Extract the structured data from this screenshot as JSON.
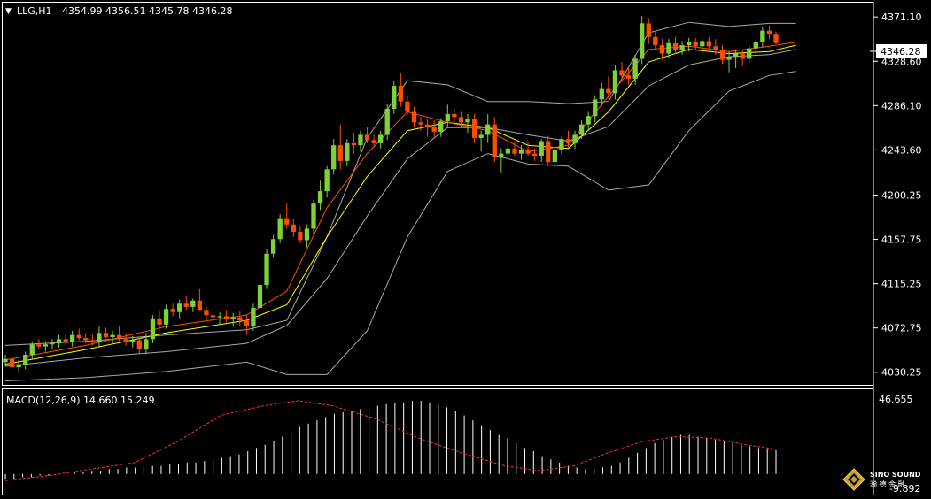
{
  "header": {
    "symbol": "LLG,H1",
    "ohlc": "4354.99 4356.51 4345.78 4346.28"
  },
  "price_axis": {
    "ticks": [
      "4371.10",
      "4328.60",
      "4286.10",
      "4243.60",
      "4200.25",
      "4157.75",
      "4115.25",
      "4072.75",
      "4030.25"
    ],
    "current_price": "4346.28"
  },
  "macd": {
    "label": "MACD(12,26,9) 14.660 15.249",
    "axis_top": "46.655",
    "axis_bottom": "-9.892"
  },
  "logo": {
    "line1": "SINO SOUND",
    "line2": "瀚 德 金 融"
  },
  "colors": {
    "background": "#000000",
    "bull": "#7fd13b",
    "bear": "#ff4d00",
    "bollinger": "#a8a8a8",
    "ma_fast": "#ff4d00",
    "ma_slow": "#ffff00",
    "macd_hist": "#ffffff",
    "macd_signal": "#ff3030",
    "axis_text": "#ffffff"
  },
  "chart_data": [
    {
      "type": "candlestick",
      "symbol": "LLG",
      "timeframe": "H1",
      "ylim": [
        4019,
        4384
      ],
      "yticks": [
        4371.1,
        4328.6,
        4286.1,
        4243.6,
        4200.25,
        4157.75,
        4115.25,
        4072.75,
        4030.25
      ],
      "last_price": 4346.28,
      "candles": [
        [
          4040,
          4047,
          4036,
          4043
        ],
        [
          4043,
          4045,
          4032,
          4035
        ],
        [
          4035,
          4042,
          4030,
          4038
        ],
        [
          4038,
          4050,
          4033,
          4047
        ],
        [
          4047,
          4060,
          4043,
          4057
        ],
        [
          4057,
          4062,
          4052,
          4055
        ],
        [
          4055,
          4060,
          4050,
          4057
        ],
        [
          4057,
          4062,
          4052,
          4058
        ],
        [
          4058,
          4066,
          4054,
          4062
        ],
        [
          4062,
          4066,
          4056,
          4059
        ],
        [
          4059,
          4070,
          4055,
          4066
        ],
        [
          4066,
          4072,
          4061,
          4063
        ],
        [
          4063,
          4068,
          4058,
          4061
        ],
        [
          4061,
          4066,
          4056,
          4059
        ],
        [
          4059,
          4074,
          4055,
          4068
        ],
        [
          4068,
          4073,
          4063,
          4064
        ],
        [
          4064,
          4070,
          4058,
          4066
        ],
        [
          4066,
          4074,
          4060,
          4062
        ],
        [
          4062,
          4068,
          4056,
          4059
        ],
        [
          4059,
          4065,
          4054,
          4061
        ],
        [
          4061,
          4064,
          4048,
          4052
        ],
        [
          4052,
          4068,
          4048,
          4062
        ],
        [
          4062,
          4085,
          4058,
          4082
        ],
        [
          4082,
          4090,
          4073,
          4076
        ],
        [
          4076,
          4095,
          4072,
          4091
        ],
        [
          4091,
          4096,
          4084,
          4088
        ],
        [
          4088,
          4100,
          4082,
          4096
        ],
        [
          4096,
          4103,
          4090,
          4093
        ],
        [
          4093,
          4101,
          4088,
          4099
        ],
        [
          4099,
          4110,
          4094,
          4090
        ],
        [
          4090,
          4093,
          4080,
          4085
        ],
        [
          4085,
          4090,
          4077,
          4083
        ],
        [
          4083,
          4088,
          4076,
          4084
        ],
        [
          4084,
          4090,
          4078,
          4081
        ],
        [
          4081,
          4087,
          4075,
          4083
        ],
        [
          4083,
          4089,
          4075,
          4080
        ],
        [
          4080,
          4085,
          4066,
          4075
        ],
        [
          4075,
          4096,
          4070,
          4092
        ],
        [
          4092,
          4118,
          4088,
          4114
        ],
        [
          4114,
          4148,
          4110,
          4144
        ],
        [
          4144,
          4162,
          4140,
          4158
        ],
        [
          4158,
          4182,
          4154,
          4178
        ],
        [
          4178,
          4192,
          4168,
          4172
        ],
        [
          4172,
          4177,
          4160,
          4165
        ],
        [
          4165,
          4170,
          4154,
          4157
        ],
        [
          4157,
          4172,
          4150,
          4168
        ],
        [
          4168,
          4196,
          4163,
          4192
        ],
        [
          4192,
          4214,
          4186,
          4204
        ],
        [
          4204,
          4228,
          4198,
          4225
        ],
        [
          4225,
          4254,
          4220,
          4248
        ],
        [
          4248,
          4268,
          4225,
          4233
        ],
        [
          4233,
          4254,
          4228,
          4250
        ],
        [
          4250,
          4260,
          4240,
          4248
        ],
        [
          4248,
          4262,
          4242,
          4258
        ],
        [
          4258,
          4266,
          4250,
          4253
        ],
        [
          4253,
          4258,
          4246,
          4250
        ],
        [
          4250,
          4262,
          4245,
          4258
        ],
        [
          4258,
          4288,
          4253,
          4283
        ],
        [
          4283,
          4310,
          4278,
          4305
        ],
        [
          4305,
          4317,
          4285,
          4290
        ],
        [
          4290,
          4295,
          4277,
          4280
        ],
        [
          4280,
          4285,
          4266,
          4270
        ],
        [
          4270,
          4275,
          4262,
          4268
        ],
        [
          4268,
          4273,
          4256,
          4266
        ],
        [
          4266,
          4272,
          4255,
          4261
        ],
        [
          4261,
          4274,
          4256,
          4271
        ],
        [
          4271,
          4287,
          4266,
          4278
        ],
        [
          4278,
          4283,
          4270,
          4275
        ],
        [
          4275,
          4280,
          4266,
          4270
        ],
        [
          4270,
          4278,
          4260,
          4273
        ],
        [
          4273,
          4278,
          4250,
          4255
        ],
        [
          4255,
          4262,
          4242,
          4258
        ],
        [
          4258,
          4278,
          4250,
          4268
        ],
        [
          4268,
          4275,
          4232,
          4236
        ],
        [
          4236,
          4245,
          4222,
          4240
        ],
        [
          4240,
          4250,
          4235,
          4245
        ],
        [
          4245,
          4251,
          4238,
          4240
        ],
        [
          4240,
          4248,
          4234,
          4244
        ],
        [
          4244,
          4251,
          4238,
          4240
        ],
        [
          4240,
          4245,
          4233,
          4238
        ],
        [
          4238,
          4254,
          4232,
          4252
        ],
        [
          4252,
          4257,
          4228,
          4232
        ],
        [
          4232,
          4246,
          4226,
          4244
        ],
        [
          4244,
          4256,
          4240,
          4254
        ],
        [
          4254,
          4262,
          4246,
          4250
        ],
        [
          4250,
          4262,
          4245,
          4258
        ],
        [
          4258,
          4272,
          4254,
          4268
        ],
        [
          4268,
          4280,
          4262,
          4276
        ],
        [
          4276,
          4296,
          4270,
          4292
        ],
        [
          4292,
          4308,
          4286,
          4302
        ],
        [
          4302,
          4314,
          4293,
          4298
        ],
        [
          4298,
          4325,
          4292,
          4320
        ],
        [
          4320,
          4328,
          4310,
          4315
        ],
        [
          4315,
          4322,
          4306,
          4312
        ],
        [
          4312,
          4335,
          4306,
          4331
        ],
        [
          4331,
          4372,
          4326,
          4365
        ],
        [
          4365,
          4370,
          4345,
          4352
        ],
        [
          4352,
          4357,
          4340,
          4344
        ],
        [
          4344,
          4350,
          4330,
          4336
        ],
        [
          4336,
          4350,
          4332,
          4346
        ],
        [
          4346,
          4352,
          4336,
          4339
        ],
        [
          4339,
          4348,
          4335,
          4344
        ],
        [
          4344,
          4351,
          4338,
          4347
        ],
        [
          4347,
          4351,
          4340,
          4343
        ],
        [
          4343,
          4350,
          4336,
          4348
        ],
        [
          4348,
          4352,
          4340,
          4343
        ],
        [
          4343,
          4350,
          4335,
          4339
        ],
        [
          4339,
          4344,
          4326,
          4330
        ],
        [
          4330,
          4338,
          4318,
          4333
        ],
        [
          4333,
          4340,
          4322,
          4336
        ],
        [
          4336,
          4340,
          4324,
          4331
        ],
        [
          4331,
          4344,
          4327,
          4341
        ],
        [
          4341,
          4350,
          4336,
          4347
        ],
        [
          4347,
          4362,
          4342,
          4358
        ],
        [
          4358,
          4363,
          4350,
          4355
        ],
        [
          4355,
          4357,
          4345,
          4346
        ]
      ],
      "bollinger_upper": [
        [
          0,
          4056
        ],
        [
          12,
          4060
        ],
        [
          24,
          4066
        ],
        [
          36,
          4071
        ],
        [
          42,
          4080
        ],
        [
          48,
          4160
        ],
        [
          54,
          4255
        ],
        [
          60,
          4310
        ],
        [
          66,
          4306
        ],
        [
          72,
          4290
        ],
        [
          78,
          4290
        ],
        [
          84,
          4288
        ],
        [
          90,
          4290
        ],
        [
          96,
          4356
        ],
        [
          102,
          4366
        ],
        [
          108,
          4362
        ],
        [
          114,
          4365
        ],
        [
          118,
          4365
        ]
      ],
      "bollinger_middle": [
        [
          0,
          4036
        ],
        [
          12,
          4044
        ],
        [
          24,
          4050
        ],
        [
          36,
          4058
        ],
        [
          42,
          4075
        ],
        [
          48,
          4120
        ],
        [
          54,
          4180
        ],
        [
          60,
          4235
        ],
        [
          66,
          4265
        ],
        [
          72,
          4265
        ],
        [
          78,
          4258
        ],
        [
          84,
          4252
        ],
        [
          90,
          4266
        ],
        [
          96,
          4305
        ],
        [
          102,
          4325
        ],
        [
          108,
          4333
        ],
        [
          114,
          4335
        ],
        [
          118,
          4340
        ]
      ],
      "bollinger_lower": [
        [
          0,
          4022
        ],
        [
          12,
          4025
        ],
        [
          24,
          4031
        ],
        [
          36,
          4040
        ],
        [
          42,
          4028
        ],
        [
          48,
          4028
        ],
        [
          54,
          4070
        ],
        [
          60,
          4160
        ],
        [
          66,
          4223
        ],
        [
          72,
          4240
        ],
        [
          78,
          4230
        ],
        [
          84,
          4228
        ],
        [
          90,
          4205
        ],
        [
          96,
          4210
        ],
        [
          102,
          4262
        ],
        [
          108,
          4300
        ],
        [
          114,
          4315
        ],
        [
          118,
          4319
        ]
      ],
      "ma_fast": [
        [
          0,
          4042
        ],
        [
          12,
          4056
        ],
        [
          24,
          4074
        ],
        [
          36,
          4085
        ],
        [
          42,
          4108
        ],
        [
          48,
          4188
        ],
        [
          54,
          4240
        ],
        [
          60,
          4280
        ],
        [
          66,
          4270
        ],
        [
          72,
          4262
        ],
        [
          78,
          4242
        ],
        [
          84,
          4248
        ],
        [
          90,
          4295
        ],
        [
          96,
          4340
        ],
        [
          102,
          4343
        ],
        [
          108,
          4338
        ],
        [
          114,
          4343
        ],
        [
          118,
          4347
        ]
      ],
      "ma_slow": [
        [
          0,
          4038
        ],
        [
          12,
          4052
        ],
        [
          24,
          4068
        ],
        [
          36,
          4080
        ],
        [
          42,
          4095
        ],
        [
          48,
          4160
        ],
        [
          54,
          4218
        ],
        [
          60,
          4262
        ],
        [
          66,
          4270
        ],
        [
          72,
          4265
        ],
        [
          78,
          4248
        ],
        [
          84,
          4245
        ],
        [
          90,
          4280
        ],
        [
          96,
          4328
        ],
        [
          102,
          4340
        ],
        [
          108,
          4336
        ],
        [
          114,
          4338
        ],
        [
          118,
          4344
        ]
      ]
    },
    {
      "type": "bar",
      "name": "MACD(12,26,9)",
      "macd_value": 14.66,
      "signal_value": 15.249,
      "ylim": [
        -9.892,
        46.655
      ],
      "histogram": [
        -3,
        -3,
        -2,
        -2,
        -1,
        -1,
        0,
        0,
        1,
        1,
        2,
        2,
        3,
        3,
        4,
        4,
        5,
        5,
        5,
        6,
        6,
        7,
        7,
        8,
        9,
        10,
        11,
        12,
        14,
        16,
        18,
        20,
        23,
        26,
        29,
        31,
        33,
        35,
        37,
        38,
        39,
        40,
        41,
        42,
        43,
        44,
        44,
        45,
        45,
        44,
        43,
        41,
        39,
        36,
        33,
        30,
        27,
        24,
        22,
        19,
        16,
        14,
        11,
        9,
        7,
        5,
        4,
        3,
        3,
        4,
        5,
        7,
        10,
        13,
        16,
        19,
        21,
        23,
        24,
        24,
        23,
        22,
        21,
        20,
        19,
        18,
        17,
        16,
        15,
        14.66
      ],
      "signal_line": [
        [
          0,
          -4
        ],
        [
          10,
          -1
        ],
        [
          20,
          3
        ],
        [
          30,
          7
        ],
        [
          40,
          20
        ],
        [
          50,
          36
        ],
        [
          60,
          42
        ],
        [
          68,
          45
        ],
        [
          76,
          42
        ],
        [
          86,
          34
        ],
        [
          96,
          22
        ],
        [
          106,
          13
        ],
        [
          116,
          5
        ],
        [
          124,
          2
        ],
        [
          132,
          5
        ],
        [
          140,
          13
        ],
        [
          148,
          20
        ],
        [
          156,
          23
        ],
        [
          164,
          22
        ],
        [
          172,
          18
        ],
        [
          179,
          15.249
        ]
      ]
    }
  ]
}
